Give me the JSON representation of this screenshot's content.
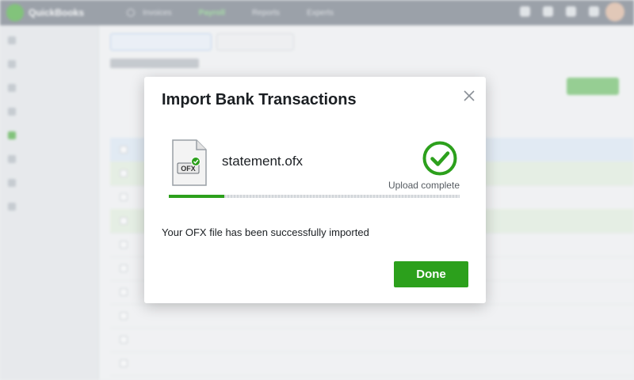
{
  "app": {
    "brand": "QuickBooks",
    "nav": [
      "Invoices",
      "Payroll",
      "Reports",
      "Experts"
    ]
  },
  "dialog": {
    "title": "Import Bank Transactions",
    "file_name": "statement.ofx",
    "file_type_badge": "OFX",
    "upload_status": "Upload complete",
    "upload_progress": 0.19,
    "message": "Your OFX file has been successfully imported",
    "done_label": "Done",
    "accent_color": "#2ca01c"
  },
  "icons": {
    "close": "close-icon",
    "file": "ofx-file-icon",
    "success": "checkmark-circle-icon"
  }
}
